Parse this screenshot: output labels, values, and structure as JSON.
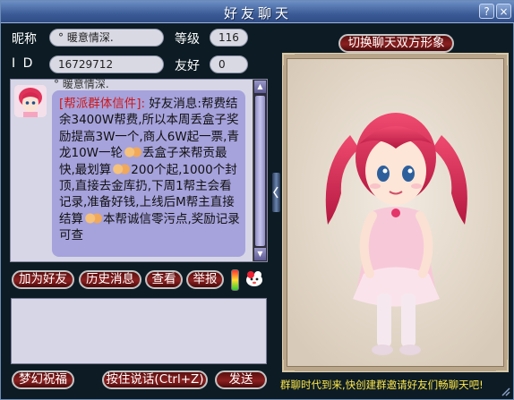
{
  "window": {
    "title": "好友聊天"
  },
  "titlebar": {
    "help_label": "?",
    "close_label": "×"
  },
  "profile": {
    "nickname_label": "昵称",
    "nickname": "° 暖意情深.",
    "level_label": "等级",
    "level": "116",
    "id_label": "I D",
    "id": "16729712",
    "friendship_label": "友好",
    "friendship": "0"
  },
  "switch_button": "切换聊天双方形象",
  "message": {
    "sender": "° 暖意情深.",
    "tag": "[帮派群体信件]:",
    "segments": [
      "好友消息:帮费结余3400W帮费,所以本周丢盒子奖励提高3W一个,商人6W起一票,青龙10W一轮",
      "丢盒子来帮贡最快,最划算",
      "200个起,1000个封顶,直接去金库扔,下周1帮主会看记录,准备好钱,上线后M帮主直接结算",
      "本帮诚信零污点,奖励记录可查"
    ],
    "emote_icon": "handshake-icon"
  },
  "actions": {
    "add_friend": "加为好友",
    "history": "历史消息",
    "view": "查看",
    "report": "举报"
  },
  "input": {
    "value": ""
  },
  "bottom": {
    "blessing": "梦幻祝福",
    "voice": "按住说话(Ctrl+Z)",
    "send": "发送",
    "promo": "群聊时代到来,快创建群邀请好友们畅聊天吧!"
  },
  "colors": {
    "tag_red": "#d01818",
    "promo_yellow": "#ffe84a",
    "button_red": "#8b2020",
    "title_blue": "#3c5c97"
  }
}
